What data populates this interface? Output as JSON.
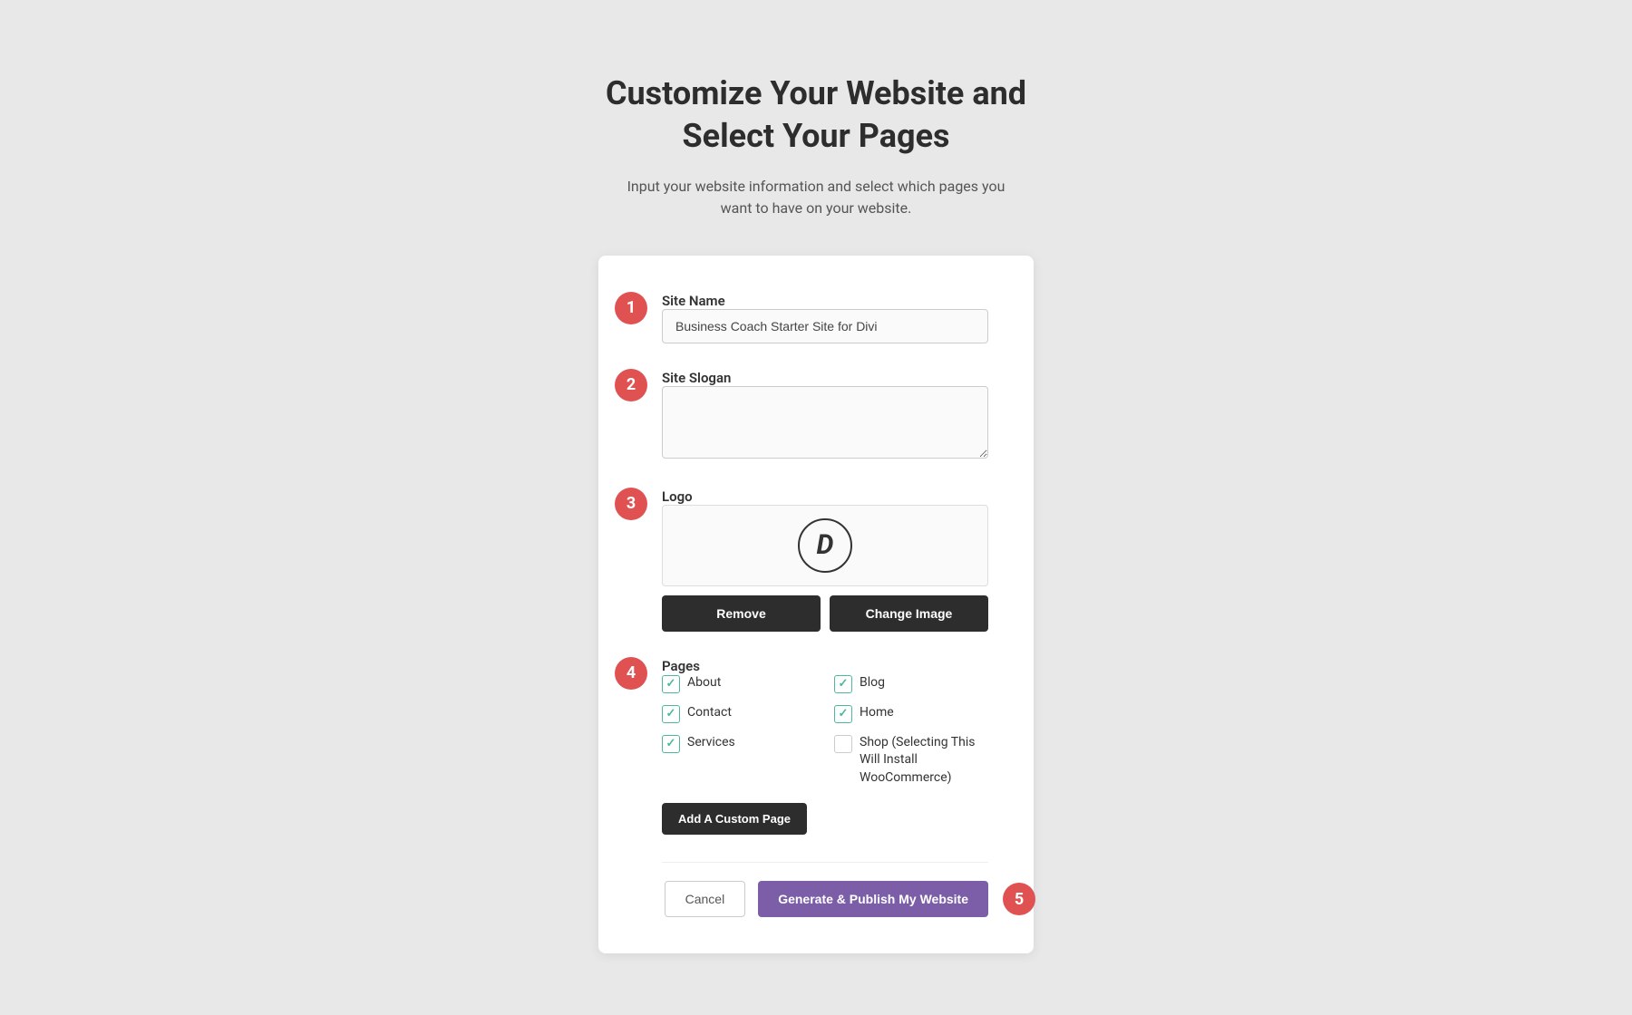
{
  "page": {
    "title_line1": "Customize Your Website and",
    "title_line2": "Select Your Pages",
    "subtitle": "Input your website information and select which pages you want to have on your website."
  },
  "steps": {
    "step1": {
      "badge": "1",
      "label": "Site Name",
      "value": "Business Coach Starter Site for Divi",
      "placeholder": "Business Coach Starter Site for Divi"
    },
    "step2": {
      "badge": "2",
      "label": "Site Slogan",
      "placeholder": ""
    },
    "step3": {
      "badge": "3",
      "label": "Logo",
      "logo_letter": "D",
      "remove_btn": "Remove",
      "change_btn": "Change Image"
    },
    "step4": {
      "badge": "4",
      "label": "Pages",
      "pages": [
        {
          "id": "about",
          "name": "About",
          "checked": true
        },
        {
          "id": "blog",
          "name": "Blog",
          "checked": true
        },
        {
          "id": "contact",
          "name": "Contact",
          "checked": true
        },
        {
          "id": "home",
          "name": "Home",
          "checked": true
        },
        {
          "id": "services",
          "name": "Services",
          "checked": true
        },
        {
          "id": "shop",
          "name": "Shop (Selecting This Will Install WooCommerce)",
          "checked": false
        }
      ],
      "custom_page_btn": "Add A Custom Page"
    }
  },
  "footer": {
    "step5_badge": "5",
    "cancel_label": "Cancel",
    "publish_label": "Generate & Publish My Website"
  }
}
